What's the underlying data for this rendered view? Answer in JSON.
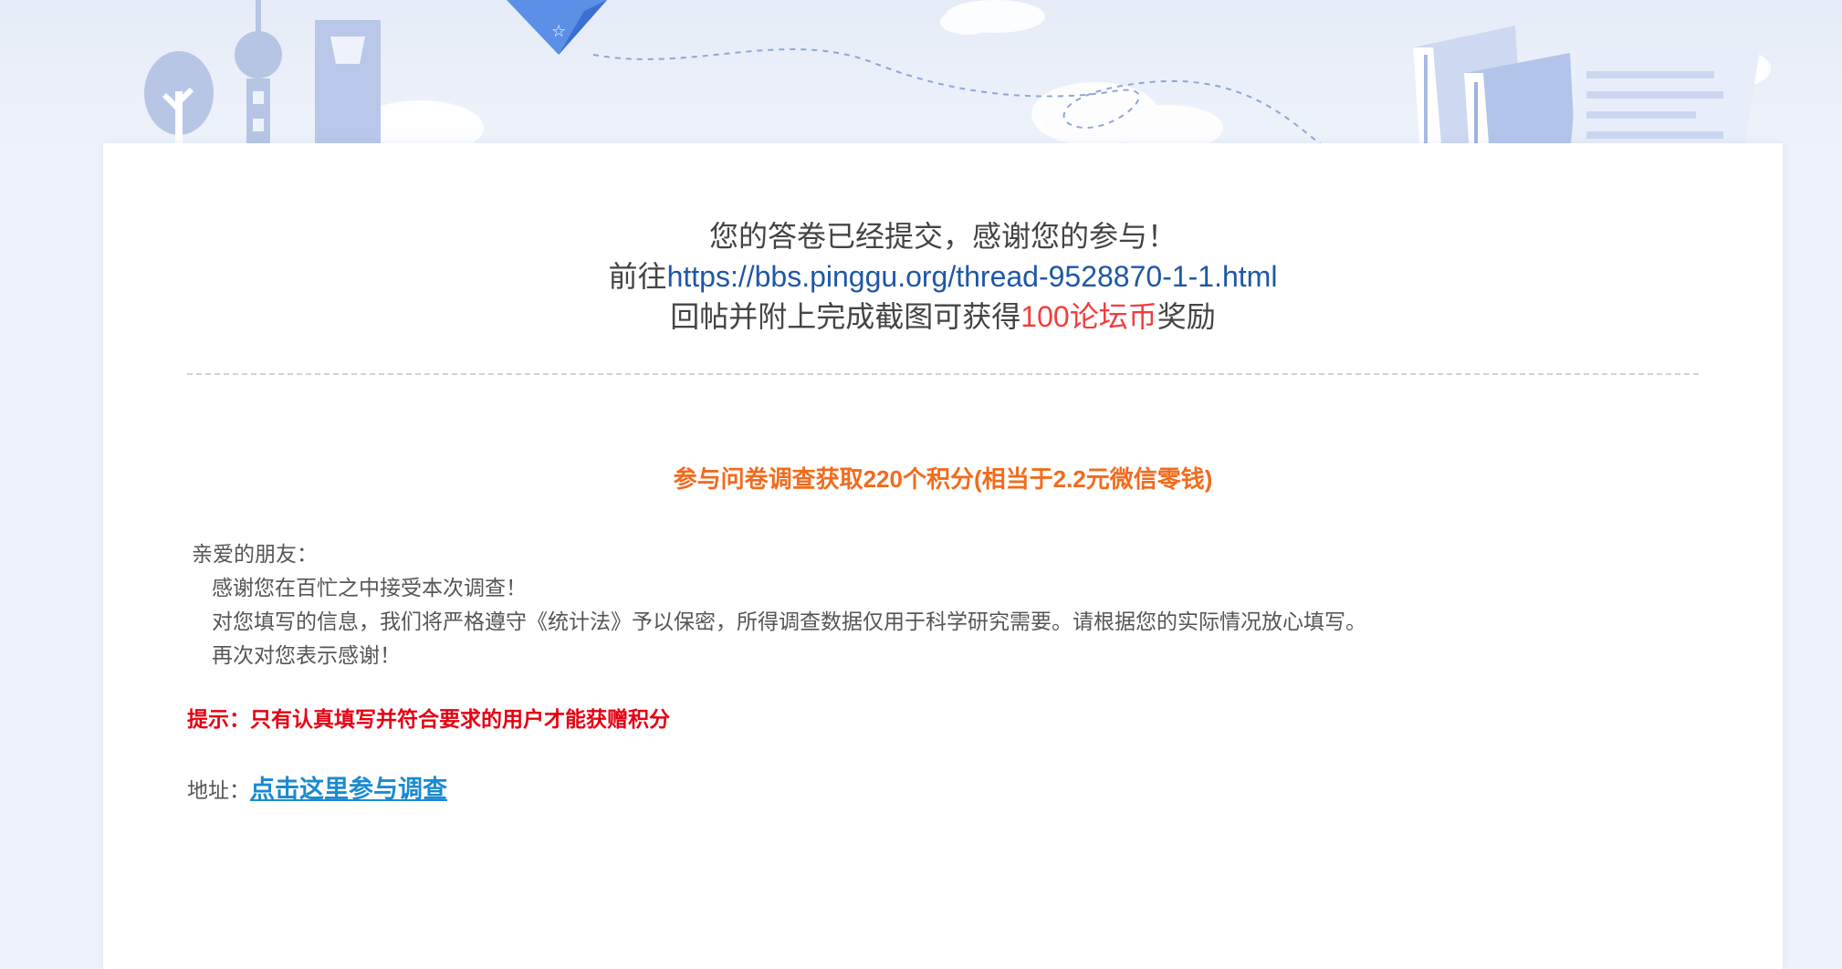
{
  "confirmation": {
    "line1": "您的答卷已经提交，感谢您的参与！",
    "line2_prefix": "前往",
    "line2_link": "https://bbs.pinggu.org/thread-9528870-1-1.html",
    "line3_prefix": "回帖并附上完成截图可获得",
    "line3_reward": "100论坛币",
    "line3_suffix": "奖励"
  },
  "survey": {
    "title": "参与问卷调查获取220个积分(相当于2.2元微信零钱)",
    "greeting": "亲爱的朋友：",
    "paragraphs": [
      "感谢您在百忙之中接受本次调查！",
      "对您填写的信息，我们将严格遵守《统计法》予以保密，所得调查数据仅用于科学研究需要。请根据您的实际情况放心填写。",
      "再次对您表示感谢！"
    ],
    "tip": "提示：只有认真填写并符合要求的用户才能获赠积分",
    "address_label": "地址：",
    "address_link": "点击这里参与调查"
  },
  "colors": {
    "link_blue": "#1e57a8",
    "reward_red": "#f23d3d",
    "title_orange": "#f26b1d",
    "tip_red": "#e60012",
    "address_link_blue": "#1a8ad1"
  }
}
